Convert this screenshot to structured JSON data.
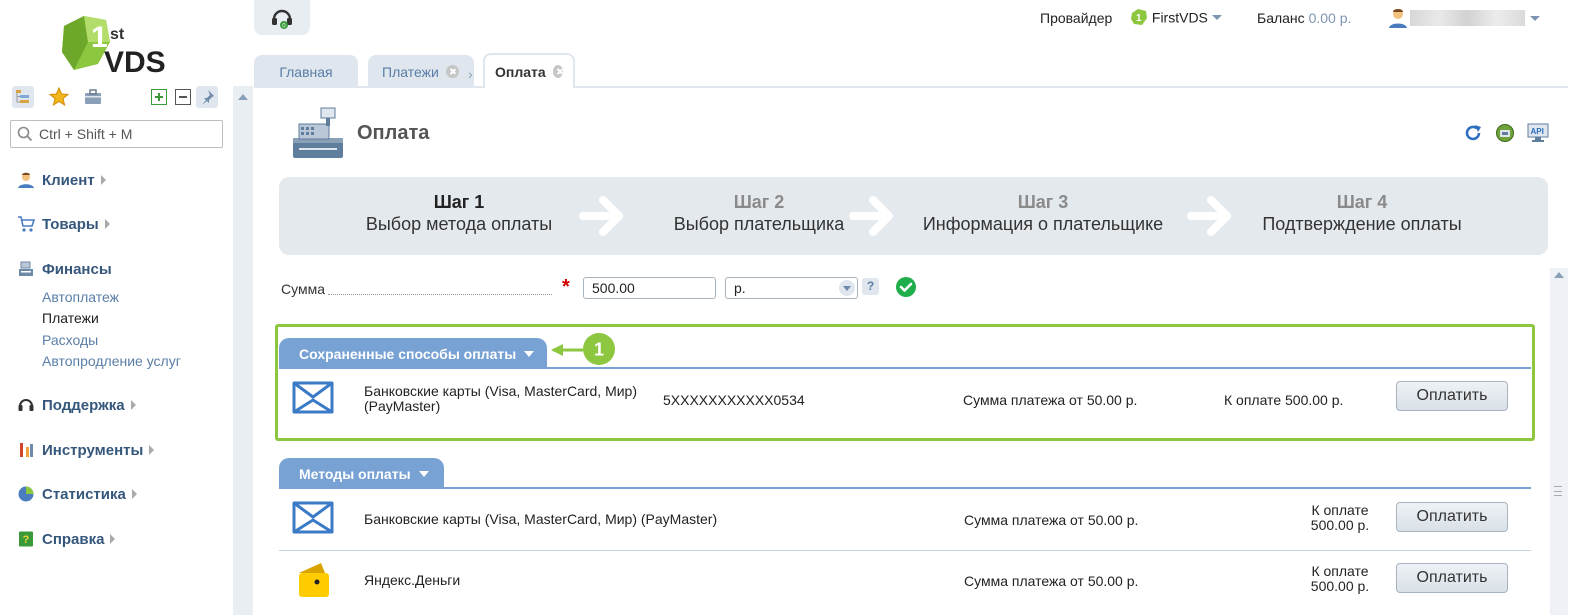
{
  "brand": {
    "logo_text": "VDS",
    "logo_sup": "st"
  },
  "search": {
    "placeholder": "Ctrl + Shift + M"
  },
  "nav": {
    "groups": [
      {
        "label": "Клиент",
        "icon": "user-icon"
      },
      {
        "label": "Товары",
        "icon": "cart-icon"
      },
      {
        "label": "Финансы",
        "icon": "cash-register-icon",
        "items": [
          "Автоплатеж",
          "Платежи",
          "Расходы",
          "Автопродление услуг"
        ],
        "active_item": "Платежи"
      },
      {
        "label": "Поддержка",
        "icon": "headset-icon"
      },
      {
        "label": "Инструменты",
        "icon": "tools-icon"
      },
      {
        "label": "Статистика",
        "icon": "pie-chart-icon"
      },
      {
        "label": "Справка",
        "icon": "help-book-icon"
      }
    ]
  },
  "topbar": {
    "provider_label": "Провайдер",
    "provider_value": "FirstVDS",
    "balance_label": "Баланс",
    "balance_value": "0.00 р."
  },
  "tabs": [
    {
      "label": "Главная",
      "closable": false
    },
    {
      "label": "Платежи",
      "closable": true
    },
    {
      "label": "Оплата",
      "closable": true,
      "active": true
    }
  ],
  "page": {
    "title": "Оплата"
  },
  "wizard": {
    "steps": [
      {
        "num": "Шаг 1",
        "name": "Выбор метода оплаты",
        "current": true
      },
      {
        "num": "Шаг 2",
        "name": "Выбор плательщика"
      },
      {
        "num": "Шаг 3",
        "name": "Информация о плательщике"
      },
      {
        "num": "Шаг 4",
        "name": "Подтверждение оплаты"
      }
    ]
  },
  "form": {
    "amount_label": "Сумма",
    "amount_value": "500.00",
    "currency_value": "р.",
    "help_glyph": "?"
  },
  "callout": {
    "number": "1",
    "color": "#8dc63f"
  },
  "saved": {
    "title": "Сохраненные способы оплаты",
    "rows": [
      {
        "name_line1": "Банковские карты (Visa, MasterCard, Мир)",
        "name_line2": "(PayMaster)",
        "account": "5XXXXXXXXXXX0534",
        "min": "Сумма платежа от 50.00 р.",
        "due": "К оплате 500.00 р.",
        "button": "Оплатить",
        "icon": "envelope-icon"
      }
    ]
  },
  "methods": {
    "title": "Методы оплаты",
    "rows": [
      {
        "name": "Банковские карты (Visa, MasterCard, Мир) (PayMaster)",
        "min": "Сумма платежа от 50.00 р.",
        "due_line1": "К оплате",
        "due_line2": "500.00 р.",
        "button": "Оплатить",
        "icon": "envelope-icon"
      },
      {
        "name": "Яндекс.Деньги",
        "min": "Сумма платежа от 50.00 р.",
        "due_line1": "К оплате",
        "due_line2": "500.00 р.",
        "button": "Оплатить",
        "icon": "yandex-wallet-icon"
      }
    ]
  },
  "colors": {
    "accent_blue": "#78a2d4",
    "nav_blue": "#35577c",
    "link_blue": "#5a7ea6",
    "highlight_green": "#8dc63f"
  }
}
